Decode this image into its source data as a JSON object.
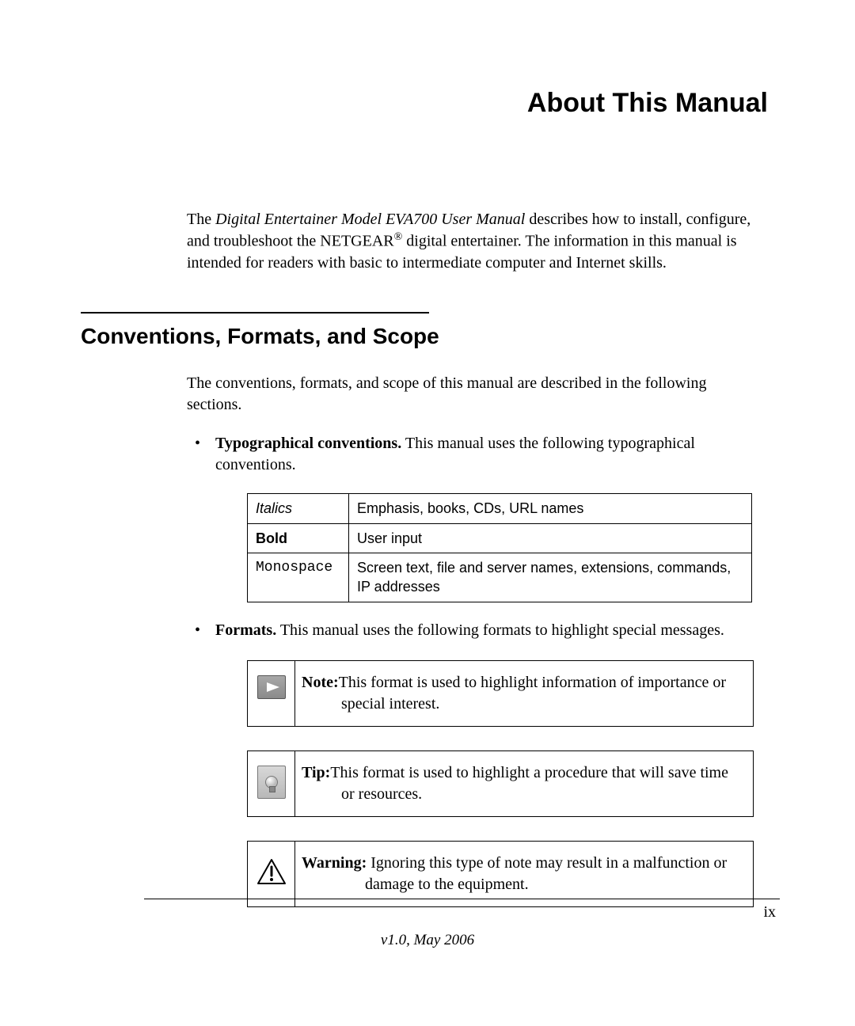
{
  "page_title": "About This Manual",
  "intro": {
    "pre": "The ",
    "italic": "Digital Entertainer Model EVA700 User Manual",
    "tail1": " describes how to install, configure, and troubleshoot the NETGEAR",
    "reg": "®",
    "tail2": " digital entertainer. The information in this manual is intended for readers with basic to intermediate computer and Internet skills."
  },
  "section_heading": "Conventions, Formats, and Scope",
  "section_intro": "The conventions, formats, and scope of this manual are described in the following sections.",
  "bullets": {
    "typo": {
      "lead": "Typographical conventions.",
      "text": " This manual uses the following typographical conventions."
    },
    "formats": {
      "lead": "Formats.",
      "text": " This manual uses the following formats to highlight special messages."
    }
  },
  "typo_table": {
    "rows": [
      {
        "convention": "Italics",
        "desc": "Emphasis, books, CDs, URL names"
      },
      {
        "convention": "Bold",
        "desc": "User input"
      },
      {
        "convention": "Monospace",
        "desc": "Screen text, file and server names, extensions, commands, IP addresses"
      }
    ]
  },
  "callouts": {
    "note": {
      "lead": "Note:",
      "line1": "This format is used to highlight information of importance or",
      "line2": "special interest."
    },
    "tip": {
      "lead": "Tip:",
      "line1": "This format is used to highlight a procedure that will save time",
      "line2": "or resources."
    },
    "warning": {
      "lead": "Warning:",
      "line1": " Ignoring this type of note may result in a malfunction or",
      "line2": "damage to the equipment."
    }
  },
  "footer": {
    "page_num": "ix",
    "version": "v1.0, May 2006"
  }
}
